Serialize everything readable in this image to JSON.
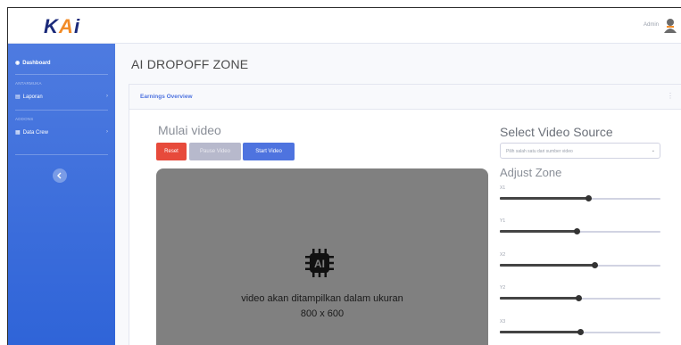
{
  "brand": {
    "logo_text": "KAI",
    "colors": {
      "navy": "#1b2a7a",
      "orange": "#f28c28"
    }
  },
  "header": {
    "user_name": "Admin"
  },
  "sidebar": {
    "items": [
      {
        "label": "Dashboard",
        "icon": "dashboard-icon"
      },
      {
        "heading": "ANTARMUKA"
      },
      {
        "label": "Laporan",
        "icon": "folder-icon"
      },
      {
        "heading": "ADDONS"
      },
      {
        "label": "Data Crew",
        "icon": "table-icon"
      }
    ]
  },
  "page": {
    "title": "AI DROPOFF ZONE"
  },
  "card": {
    "header_title": "Earnings Overview"
  },
  "video": {
    "title": "Mulai video",
    "buttons": {
      "reset": "Reset",
      "pause": "Pause Video",
      "start": "Start Video"
    },
    "placeholder_line1": "video akan ditampilkan dalam ukuran",
    "placeholder_line2": "800 x 600"
  },
  "source": {
    "title": "Select Video Source",
    "placeholder": "Pilih salah satu dari sumber video"
  },
  "zone": {
    "title": "Adjust Zone",
    "sliders": [
      {
        "label": "X1",
        "value": 0.55
      },
      {
        "label": "Y1",
        "value": 0.48
      },
      {
        "label": "X2",
        "value": 0.59
      },
      {
        "label": "Y2",
        "value": 0.49
      },
      {
        "label": "X3",
        "value": 0.5
      }
    ]
  }
}
